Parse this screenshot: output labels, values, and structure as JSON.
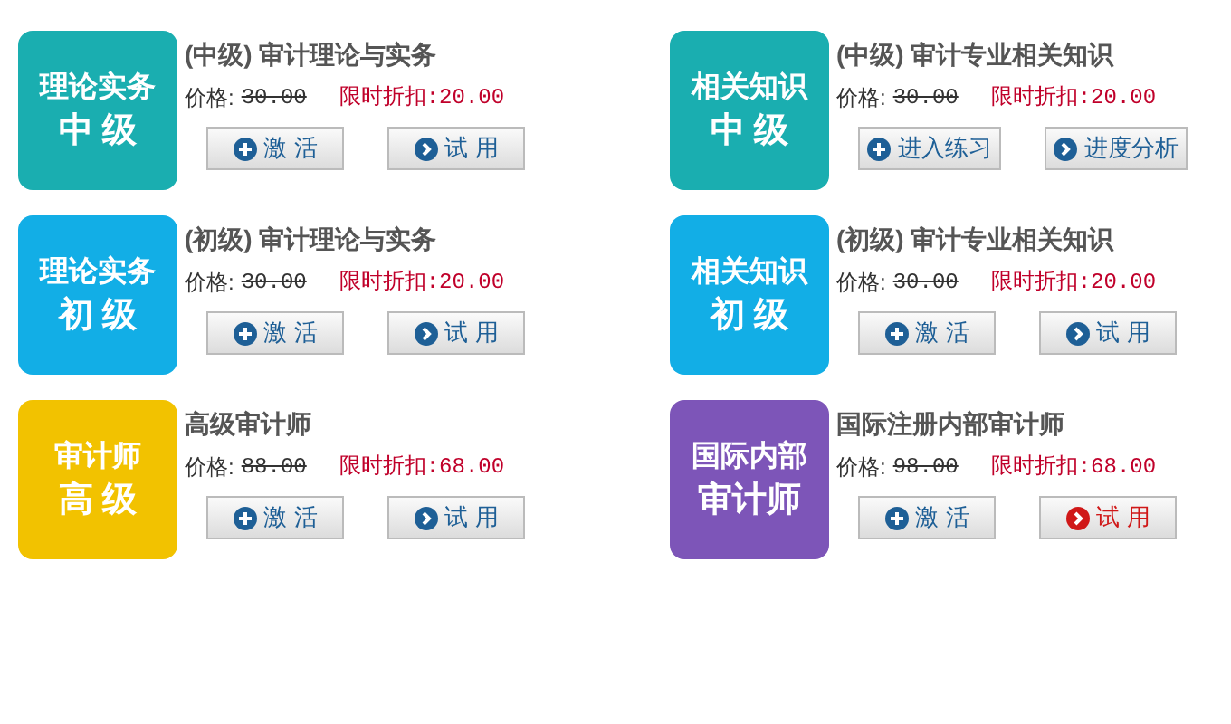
{
  "courses": [
    {
      "tile": {
        "line1": "理论实务",
        "line2": "中 级",
        "color": "#1aaeb0"
      },
      "title": "(中级) 审计理论与实务",
      "price_label": "价格:",
      "price": "30.00",
      "discount": "限时折扣:20.00",
      "buttons": [
        {
          "kind": "plus",
          "label": "激 活",
          "color": "#1e5f96"
        },
        {
          "kind": "arrow",
          "label": "试 用",
          "color": "#1e5f96"
        }
      ]
    },
    {
      "tile": {
        "line1": "相关知识",
        "line2": "中 级",
        "color": "#1aaeb0"
      },
      "title": "(中级) 审计专业相关知识",
      "price_label": "价格:",
      "price": "30.00",
      "discount": "限时折扣:20.00",
      "buttons": [
        {
          "kind": "plus",
          "label": "进入练习",
          "color": "#1e5f96"
        },
        {
          "kind": "arrow",
          "label": "进度分析",
          "color": "#1e5f96"
        }
      ]
    },
    {
      "tile": {
        "line1": "理论实务",
        "line2": "初 级",
        "color": "#12aee6"
      },
      "title": "(初级) 审计理论与实务",
      "price_label": "价格:",
      "price": "30.00",
      "discount": "限时折扣:20.00",
      "buttons": [
        {
          "kind": "plus",
          "label": "激 活",
          "color": "#1e5f96"
        },
        {
          "kind": "arrow",
          "label": "试 用",
          "color": "#1e5f96"
        }
      ]
    },
    {
      "tile": {
        "line1": "相关知识",
        "line2": "初 级",
        "color": "#12aee6"
      },
      "title": "(初级) 审计专业相关知识",
      "price_label": "价格:",
      "price": "30.00",
      "discount": "限时折扣:20.00",
      "buttons": [
        {
          "kind": "plus",
          "label": "激 活",
          "color": "#1e5f96"
        },
        {
          "kind": "arrow",
          "label": "试 用",
          "color": "#1e5f96"
        }
      ]
    },
    {
      "tile": {
        "line1": "审计师",
        "line2": "高 级",
        "color": "#f2c200"
      },
      "title": "高级审计师",
      "price_label": "价格:",
      "price": "88.00",
      "discount": "限时折扣:68.00",
      "buttons": [
        {
          "kind": "plus",
          "label": "激 活",
          "color": "#1e5f96"
        },
        {
          "kind": "arrow",
          "label": "试 用",
          "color": "#1e5f96"
        }
      ]
    },
    {
      "tile": {
        "line1": "国际内部",
        "line2": "审计师",
        "color": "#7d55b8"
      },
      "title": "国际注册内部审计师",
      "price_label": "价格:",
      "price": "98.00",
      "discount": "限时折扣:68.00",
      "buttons": [
        {
          "kind": "plus",
          "label": "激 活",
          "color": "#1e5f96"
        },
        {
          "kind": "arrow",
          "label": "试 用",
          "color": "#d01818"
        }
      ]
    }
  ]
}
